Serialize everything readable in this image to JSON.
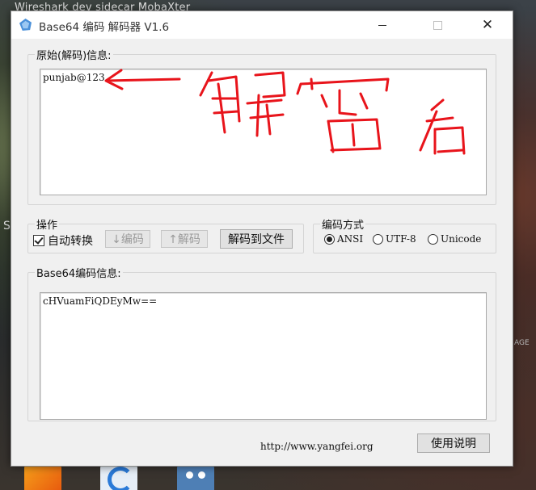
{
  "desktop": {
    "top_window_title": "Wireshark  dev sidecar  MobaXter",
    "left_edge_char": "S",
    "right_edge_char": "AGE"
  },
  "window": {
    "title": "Base64 编码 解码器 V1.6"
  },
  "original": {
    "legend": "原始(解码)信息:",
    "text": "punjab@123"
  },
  "operations": {
    "legend": "操作",
    "auto_convert_label": "自动转换",
    "auto_convert_checked": true,
    "encode_button": "↓编码",
    "decode_button": "↑解码",
    "decode_to_file_button": "解码到文件"
  },
  "encoding": {
    "legend": "编码方式",
    "options": [
      "ANSI",
      "UTF-8",
      "Unicode"
    ],
    "selected": "ANSI"
  },
  "base64": {
    "legend": "Base64编码信息:",
    "text": "cHVuamFiQDEyMw=="
  },
  "footer": {
    "url": "http://www.yangfei.org",
    "help_button": "使用说明"
  },
  "colors": {
    "annotation_ink": "#e8141b",
    "window_bg": "#f0f0f0"
  }
}
